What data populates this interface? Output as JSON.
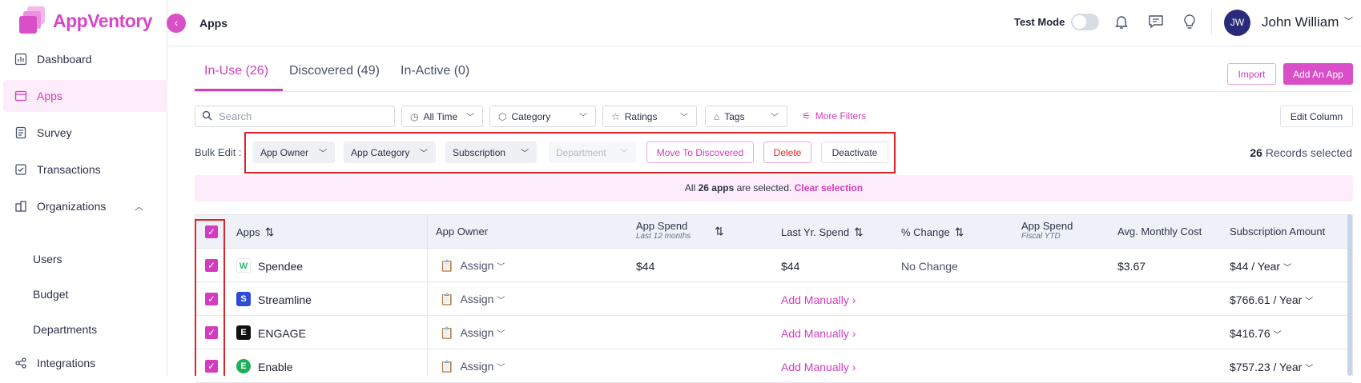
{
  "brand": {
    "name": "AppVentory",
    "accent": "#d33cbf"
  },
  "sidebar": {
    "items": [
      {
        "label": "Dashboard",
        "icon": "chart-icon"
      },
      {
        "label": "Apps",
        "icon": "window-icon"
      },
      {
        "label": "Survey",
        "icon": "document-icon"
      },
      {
        "label": "Transactions",
        "icon": "checklist-icon"
      },
      {
        "label": "Organizations",
        "icon": "building-icon"
      },
      {
        "label": "Integrations",
        "icon": "share-icon"
      }
    ],
    "sub_items": [
      "Users",
      "Budget",
      "Departments"
    ]
  },
  "header": {
    "title": "Apps",
    "test_mode": "Test Mode",
    "user_initials": "JW",
    "user_name": "John William"
  },
  "tabs": [
    "In-Use (26)",
    "Discovered (49)",
    "In-Active (0)"
  ],
  "actions": {
    "import": "Import",
    "add_app": "Add An App",
    "edit_column": "Edit Column"
  },
  "filters": {
    "search_placeholder": "Search",
    "time": "All Time",
    "category": "Category",
    "ratings": "Ratings",
    "tags": "Tags",
    "more": "More Filters"
  },
  "bulk": {
    "label": "Bulk Edit :",
    "app_owner": "App Owner",
    "app_category": "App Category",
    "subscription": "Subscription",
    "department": "Department",
    "move": "Move To Discovered",
    "delete": "Delete",
    "deactivate": "Deactivate",
    "records_count": "26",
    "records_text": "Records selected"
  },
  "banner": {
    "pre": "All",
    "count": "26 apps",
    "post": "are selected.",
    "clear": "Clear selection"
  },
  "table": {
    "headers": {
      "apps": "Apps",
      "owner": "App Owner",
      "spend": "App Spend",
      "spend_sub": "Last 12 months",
      "last_yr": "Last Yr. Spend",
      "change": "% Change",
      "spend_fy": "App Spend",
      "spend_fy_sub": "Fiscal YTD",
      "avg": "Avg. Monthly Cost",
      "sub_amount": "Subscription Amount"
    },
    "rows": [
      {
        "name": "Spendee",
        "owner": "Assign",
        "spend": "$44",
        "last_yr": "$44",
        "change": "No Change",
        "avg": "$3.67",
        "sub": "$44 / Year",
        "logo": "W"
      },
      {
        "name": "Streamline",
        "owner": "Assign",
        "spend": "",
        "last_yr": "Add Manually",
        "change": "",
        "avg": "",
        "sub": "$766.61 / Year",
        "logo": "S"
      },
      {
        "name": "ENGAGE",
        "owner": "Assign",
        "spend": "",
        "last_yr": "Add Manually",
        "change": "",
        "avg": "",
        "sub": "$416.76",
        "logo": "E"
      },
      {
        "name": "Enable",
        "owner": "Assign",
        "spend": "",
        "last_yr": "Add Manually",
        "change": "",
        "avg": "",
        "sub": "$757.23 / Year",
        "logo": "E"
      }
    ]
  }
}
